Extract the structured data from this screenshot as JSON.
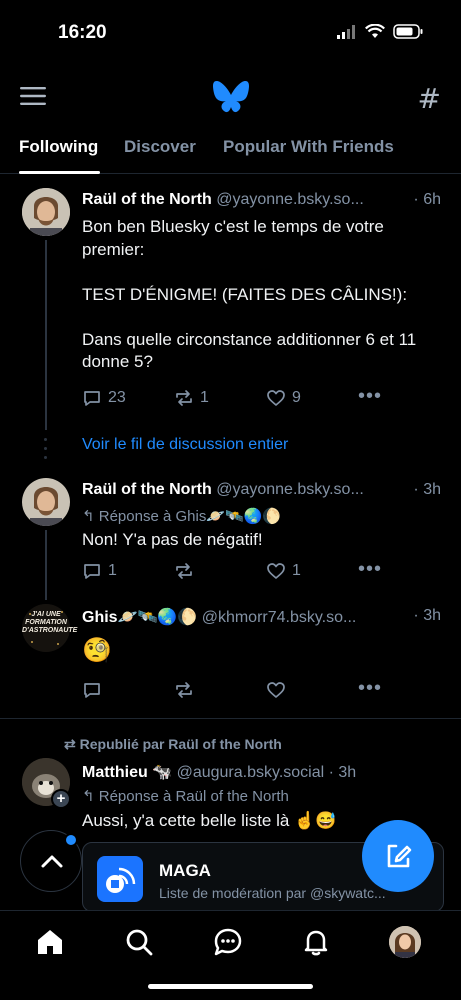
{
  "status_bar": {
    "time": "16:20"
  },
  "header": {
    "menu_icon": "hamburger-menu-icon",
    "logo_icon": "butterfly-logo-icon",
    "feeds_icon": "hashtag-icon"
  },
  "tabs": [
    {
      "label": "Following",
      "active": true
    },
    {
      "label": "Discover",
      "active": false
    },
    {
      "label": "Popular With Friends",
      "active": false
    }
  ],
  "posts": [
    {
      "author": "Raül of the North",
      "handle": "@yayonne.bsky.so...",
      "time": "· 6h",
      "text": "Bon ben Bluesky c'est le temps de votre premier:\n\nTEST D'ÉNIGME! (FAITES DES CÂLINS!):\n\nDans quelle circonstance additionner 6 et 11 donne 5?",
      "replies": "23",
      "reposts": "1",
      "likes": "9"
    },
    {
      "author": "Raül of the North",
      "handle": "@yayonne.bsky.so...",
      "time": "· 3h",
      "reply_to": "Réponse à Ghis🪐🛰️🌏🌔",
      "text": "Non! Y'a pas de négatif!",
      "replies": "1",
      "reposts": "",
      "likes": "1"
    },
    {
      "author": "Ghis🪐🛰️🌏🌔",
      "handle": "@khmorr74.bsky.so...",
      "time": "· 3h",
      "text": "🧐",
      "avatar_text": "J'AI UNE FORMATION D'ASTRONAUTE"
    },
    {
      "repost_label": "Republié par Raül of the North",
      "author": "Matthieu 🐄",
      "handle": "@augura.bsky.social",
      "time": "· 3h",
      "reply_to": "Réponse à Raül of the North",
      "text": "Aussi, y'a cette belle liste là ☝️😅",
      "embed_title": "MAGA",
      "embed_sub": "Liste de modération par @skywatc..."
    }
  ],
  "thread_link": "Voir le fil de discussion entier",
  "more_label": "•••",
  "colors": {
    "accent": "#208bfe",
    "muted": "#8392a5",
    "background": "#000000",
    "border": "#1e2630"
  },
  "bottom_nav": [
    "home-icon",
    "search-icon",
    "chat-icon",
    "bell-icon",
    "profile-avatar"
  ]
}
